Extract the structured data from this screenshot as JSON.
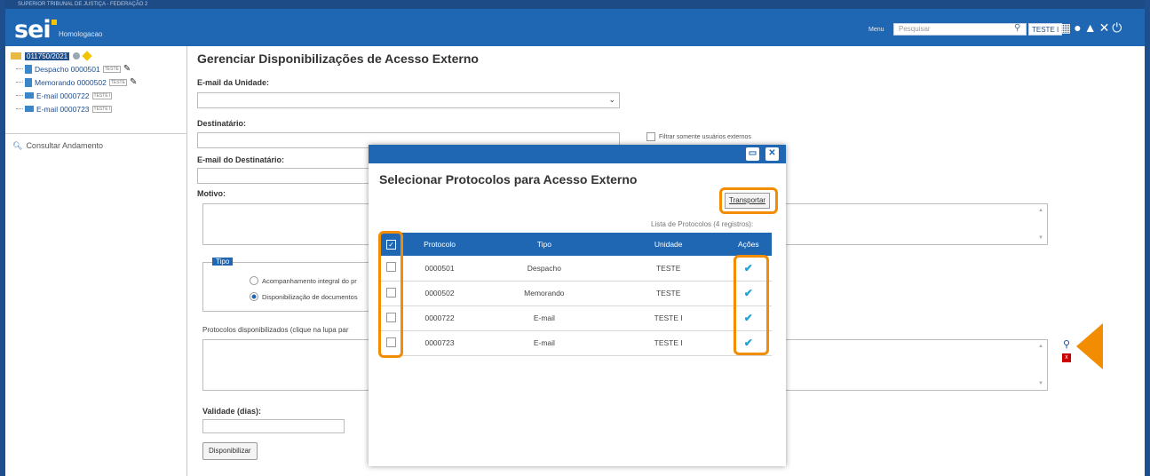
{
  "header": {
    "org": "SUPERIOR TRIBUNAL DE JUSTIÇA - FEDERAÇÃO 2",
    "logo": "sei",
    "environment": "Homologacao",
    "menu_label": "Menu",
    "search_placeholder": "Pesquisar",
    "unit": "TESTE I"
  },
  "sidebar": {
    "process_number": "011750/2021",
    "documents": [
      {
        "name": "Despacho 0000501",
        "tag": "TESTE",
        "kind": "doc"
      },
      {
        "name": "Memorando 0000502",
        "tag": "TESTE",
        "kind": "doc"
      },
      {
        "name": "E-mail 0000722",
        "tag": "TESTE I",
        "kind": "mail"
      },
      {
        "name": "E-mail 0000723",
        "tag": "TESTE I",
        "kind": "mail"
      }
    ],
    "consultar": "Consultar Andamento"
  },
  "main": {
    "title": "Gerenciar Disponibilizações de Acesso Externo",
    "email_unidade_label": "E-mail da Unidade:",
    "destinatario_label": "Destinatário:",
    "filtrar_label": "Filtrar somente usuários externos",
    "email_dest_label": "E-mail do Destinatário:",
    "motivo_label": "Motivo:",
    "tipo_legend": "Tipo",
    "tipo_opt1": "Acompanhamento integral do pr",
    "tipo_opt2": "Disponibilização de documentos",
    "protocolos_label": "Protocolos disponibilizados (clique na lupa par",
    "validade_label": "Validade (dias):",
    "disponibilizar_btn": "Disponibilizar"
  },
  "modal": {
    "title": "Selecionar Protocolos para Acesso Externo",
    "transportar_btn": "Transportar",
    "caption": "Lista de Protocolos (4 registros):",
    "columns": [
      "Protocolo",
      "Tipo",
      "Unidade",
      "Ações"
    ],
    "rows": [
      {
        "protocolo": "0000501",
        "tipo": "Despacho",
        "unidade": "TESTE"
      },
      {
        "protocolo": "0000502",
        "tipo": "Memorando",
        "unidade": "TESTE"
      },
      {
        "protocolo": "0000722",
        "tipo": "E-mail",
        "unidade": "TESTE I"
      },
      {
        "protocolo": "0000723",
        "tipo": "E-mail",
        "unidade": "TESTE I"
      }
    ]
  },
  "colors": {
    "brand_blue": "#1f67b3",
    "highlight": "#f28c00"
  }
}
